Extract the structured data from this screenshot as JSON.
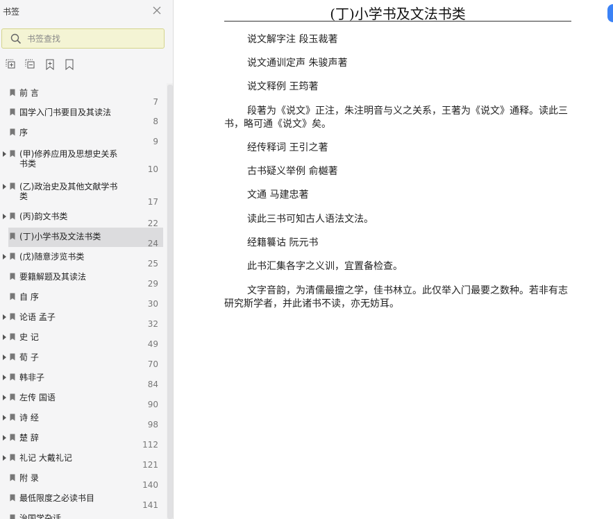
{
  "sidebar": {
    "title": "书签",
    "search_placeholder": "书签查找",
    "tools": [
      {
        "icon": "expand-all-icon"
      },
      {
        "icon": "collapse-all-icon"
      },
      {
        "icon": "add-bookmark-icon"
      },
      {
        "icon": "bookmark-icon"
      }
    ],
    "items": [
      {
        "label": "前 言",
        "page": "7",
        "expandable": false,
        "selected": false
      },
      {
        "label": "国学入门书要目及其读法",
        "page": "8",
        "expandable": false,
        "selected": false
      },
      {
        "label": "序",
        "page": "9",
        "expandable": false,
        "selected": false
      },
      {
        "label": "(甲)修养应用及思想史关系书类",
        "page": "10",
        "expandable": true,
        "selected": false
      },
      {
        "label": "(乙)政治史及其他文献学书类",
        "page": "17",
        "expandable": true,
        "selected": false
      },
      {
        "label": "(丙)韵文书类",
        "page": "22",
        "expandable": true,
        "selected": false
      },
      {
        "label": "(丁)小学书及文法书类",
        "page": "24",
        "expandable": false,
        "selected": true
      },
      {
        "label": "(戊)随意涉览书类",
        "page": "25",
        "expandable": true,
        "selected": false
      },
      {
        "label": "要籍解题及其读法",
        "page": "29",
        "expandable": false,
        "selected": false
      },
      {
        "label": "自 序",
        "page": "30",
        "expandable": false,
        "selected": false
      },
      {
        "label": "论语 孟子",
        "page": "32",
        "expandable": true,
        "selected": false
      },
      {
        "label": "史 记",
        "page": "49",
        "expandable": true,
        "selected": false
      },
      {
        "label": "荀 子",
        "page": "70",
        "expandable": true,
        "selected": false
      },
      {
        "label": "韩非子",
        "page": "84",
        "expandable": true,
        "selected": false
      },
      {
        "label": "左传 国语",
        "page": "90",
        "expandable": true,
        "selected": false
      },
      {
        "label": "诗 经",
        "page": "98",
        "expandable": true,
        "selected": false
      },
      {
        "label": "楚 辞",
        "page": "112",
        "expandable": true,
        "selected": false
      },
      {
        "label": "礼记 大戴礼记",
        "page": "121",
        "expandable": true,
        "selected": false
      },
      {
        "label": "附 录",
        "page": "140",
        "expandable": false,
        "selected": false
      },
      {
        "label": "最低限度之必读书目",
        "page": "141",
        "expandable": false,
        "selected": false
      },
      {
        "label": "治国学杂话",
        "page": "",
        "expandable": false,
        "selected": false
      }
    ]
  },
  "document": {
    "heading": "(丁)小学书及文法书类",
    "paragraphs": [
      "说文解字注 段玉裁著",
      "说文通训定声 朱骏声著",
      "说文释例 王筠著",
      "段著为《说文》正注，朱注明音与义之关系，王著为《说文》通释。读此三书，略可通《说文》矣。",
      "经传释词 王引之著",
      "古书疑义举例 俞樾著",
      "文通 马建忠著",
      "读此三书可知古人语法文法。",
      "经籍籑诂 阮元书",
      "此书汇集各字之义训，宜置备检查。",
      "文字音韵，为清儒最擅之学，佳书林立。此仅举入门最要之数种。若非有志研究斯学者，并此诸书不读，亦无妨耳。"
    ]
  },
  "colors": {
    "selected_bg": "#dcdcde",
    "search_bg": "#f4f4d4",
    "accent": "#3b82f6"
  }
}
